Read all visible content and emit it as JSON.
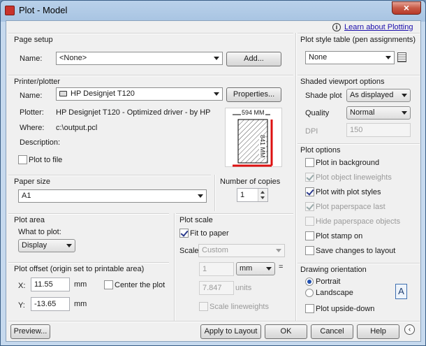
{
  "window": {
    "title": "Plot - Model",
    "close_glyph": "×"
  },
  "help": {
    "icon": "info-icon",
    "link": "Learn about Plotting"
  },
  "page_setup": {
    "title": "Page setup",
    "name_label": "Name:",
    "name_value": "<None>",
    "add_button": "Add..."
  },
  "printer": {
    "title": "Printer/plotter",
    "name_label": "Name:",
    "name_value": "HP Designjet T120",
    "properties_button": "Properties...",
    "plotter_label": "Plotter:",
    "plotter_value": "HP Designjet T120 - Optimized driver - by HP",
    "where_label": "Where:",
    "where_value": "c:\\output.pcl",
    "description_label": "Description:",
    "plot_to_file": "Plot to file",
    "preview_width": "594 MM",
    "preview_height": "841 MM"
  },
  "paper_size": {
    "title": "Paper size",
    "value": "A1"
  },
  "copies": {
    "title": "Number of copies",
    "value": "1"
  },
  "plot_area": {
    "title": "Plot area",
    "what_label": "What to plot:",
    "what_value": "Display"
  },
  "plot_offset": {
    "title": "Plot offset (origin set to printable area)",
    "x_label": "X:",
    "x_value": "11.55",
    "x_unit": "mm",
    "y_label": "Y:",
    "y_value": "-13.65",
    "y_unit": "mm",
    "center": "Center the plot"
  },
  "plot_scale": {
    "title": "Plot scale",
    "fit": "Fit to paper",
    "scale_label": "Scale:",
    "scale_value": "Custom",
    "num": "1",
    "unit": "mm",
    "equals": "=",
    "den": "7.847",
    "den_unit": "units",
    "scale_lineweights": "Scale lineweights"
  },
  "plot_style_table": {
    "title": "Plot style table (pen assignments)",
    "value": "None"
  },
  "shaded": {
    "title": "Shaded viewport options",
    "shade_label": "Shade plot",
    "shade_value": "As displayed",
    "quality_label": "Quality",
    "quality_value": "Normal",
    "dpi_label": "DPI",
    "dpi_value": "150"
  },
  "plot_options": {
    "title": "Plot options",
    "items": [
      {
        "label": "Plot in background",
        "checked": false,
        "disabled": false
      },
      {
        "label": "Plot object lineweights",
        "checked": true,
        "disabled": true
      },
      {
        "label": "Plot with plot styles",
        "checked": true,
        "disabled": false
      },
      {
        "label": "Plot paperspace last",
        "checked": true,
        "disabled": true
      },
      {
        "label": "Hide paperspace objects",
        "checked": false,
        "disabled": true
      },
      {
        "label": "Plot stamp on",
        "checked": false,
        "disabled": false
      },
      {
        "label": "Save changes to layout",
        "checked": false,
        "disabled": false
      }
    ]
  },
  "orientation": {
    "title": "Drawing orientation",
    "portrait": "Portrait",
    "landscape": "Landscape",
    "upside_down": "Plot upside-down",
    "icon_letter": "A"
  },
  "footer": {
    "preview": "Preview...",
    "apply": "Apply to Layout",
    "ok": "OK",
    "cancel": "Cancel",
    "help": "Help"
  }
}
